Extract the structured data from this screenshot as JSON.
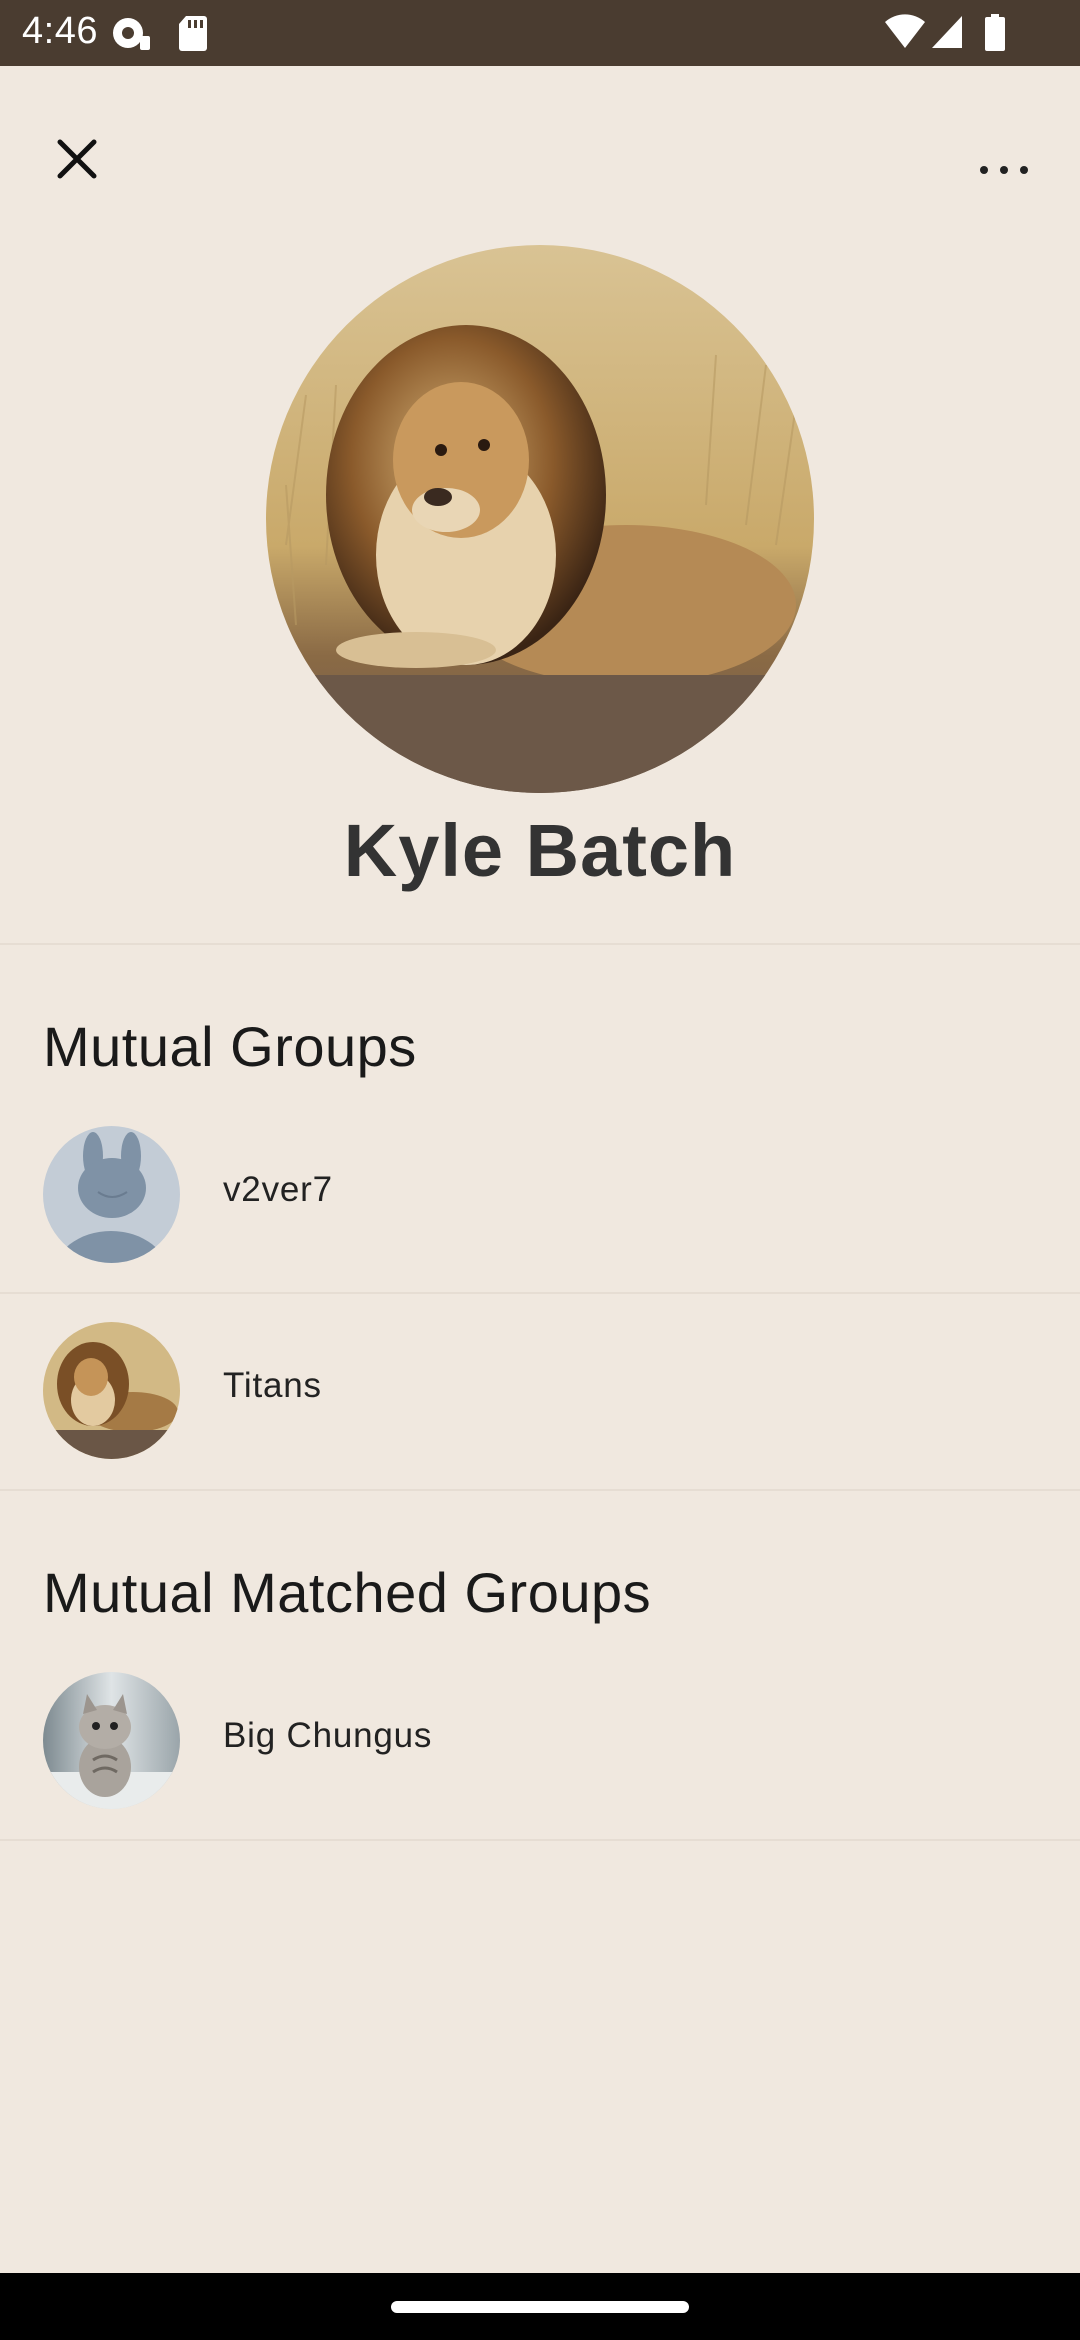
{
  "status_bar": {
    "time": "4:46",
    "background_color": "#4a3c30",
    "icons": [
      "debug-notification-icon",
      "sd-card-icon",
      "wifi-icon",
      "cellular-signal-icon",
      "battery-icon"
    ]
  },
  "header": {
    "close_icon": "close-icon",
    "more_icon": "more-horizontal-icon"
  },
  "profile": {
    "name": "Kyle Batch",
    "photo": "lion-photo"
  },
  "mutual_groups": {
    "heading": "Mutual Groups",
    "items": [
      {
        "label": "v2ver7",
        "avatar": "default-avatar-placeholder"
      },
      {
        "label": "Titans",
        "avatar": "lion-photo"
      }
    ]
  },
  "mutual_matched_groups": {
    "heading": "Mutual Matched Groups",
    "items": [
      {
        "label": "Big Chungus",
        "avatar": "kitten-photo"
      }
    ]
  },
  "colors": {
    "background": "#f0e8df",
    "text_primary": "#1a1a1a",
    "name_text": "#333333"
  }
}
